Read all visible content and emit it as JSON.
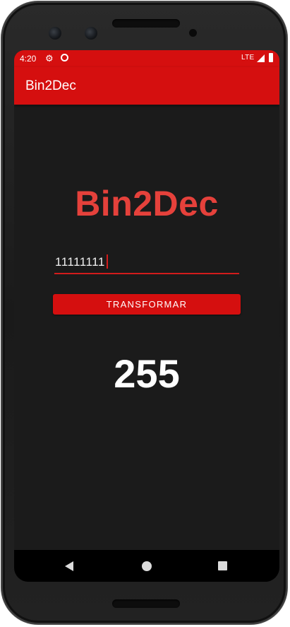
{
  "status_bar": {
    "time": "4:20",
    "network": "LTE",
    "icons": [
      "settings-gear-icon",
      "sync-circle-icon",
      "signal-icon",
      "battery-icon"
    ]
  },
  "app_bar": {
    "title": "Bin2Dec"
  },
  "main": {
    "heading": "Bin2Dec",
    "input": {
      "value": "11111111"
    },
    "button_label": "TRANSFORMAR",
    "result": "255"
  },
  "nav_bar": {
    "icons": [
      "back-icon",
      "home-icon",
      "recents-icon"
    ]
  },
  "colors": {
    "primary": "#d50f0f",
    "heading": "#e5413b",
    "background": "#1b1b1b",
    "result_text": "#ffffff"
  }
}
